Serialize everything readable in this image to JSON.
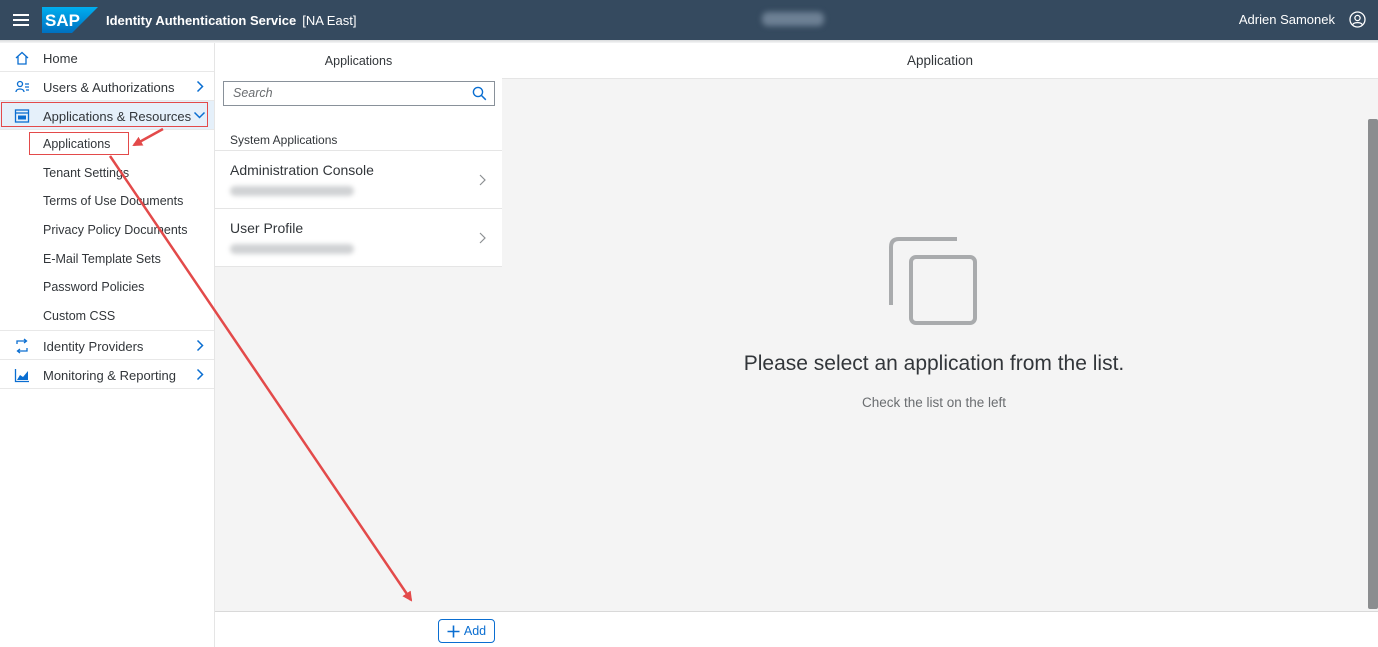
{
  "shell": {
    "product_title": "Identity Authentication Service",
    "tenant": "[NA East]",
    "user_name": "Adrien Samonek",
    "logo_text": "SAP",
    "bar_color": "#354a5f"
  },
  "sidebar": {
    "items": [
      {
        "label": "Home",
        "icon": "home-icon"
      },
      {
        "label": "Users & Authorizations",
        "icon": "users-icon"
      },
      {
        "label": "Applications & Resources",
        "icon": "applications-icon"
      },
      {
        "label": "Identity Providers",
        "icon": "identity-providers-icon"
      },
      {
        "label": "Monitoring & Reporting",
        "icon": "monitoring-icon"
      }
    ],
    "sub_items": [
      "Applications",
      "Tenant Settings",
      "Terms of Use Documents",
      "Privacy Policy Documents",
      "E-Mail Template Sets",
      "Password Policies",
      "Custom CSS"
    ]
  },
  "master": {
    "header": "Applications",
    "search_placeholder": "Search",
    "group_header": "System Applications",
    "rows": [
      {
        "title": "Administration Console"
      },
      {
        "title": "User Profile"
      }
    ]
  },
  "detail": {
    "header": "Application",
    "empty_title": "Please select an application from the list.",
    "empty_subtitle": "Check the list on the left"
  },
  "footer": {
    "add_label": "Add"
  },
  "colors": {
    "accent": "#0a6ed1",
    "annotation": "#e34a4a",
    "selected_bg": "#e5f0fa"
  }
}
